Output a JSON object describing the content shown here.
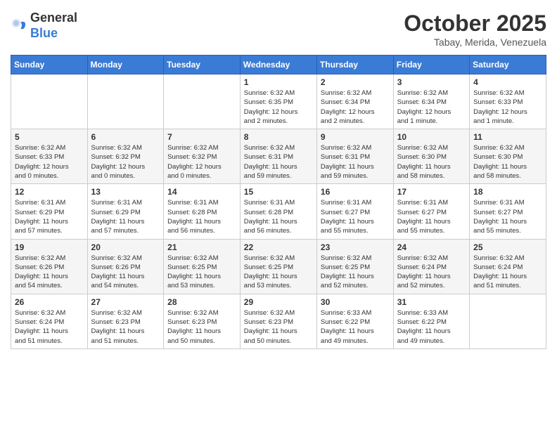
{
  "header": {
    "logo": {
      "general": "General",
      "blue": "Blue"
    },
    "title": "October 2025",
    "location": "Tabay, Merida, Venezuela"
  },
  "days_of_week": [
    "Sunday",
    "Monday",
    "Tuesday",
    "Wednesday",
    "Thursday",
    "Friday",
    "Saturday"
  ],
  "weeks": [
    [
      {
        "day": "",
        "info": ""
      },
      {
        "day": "",
        "info": ""
      },
      {
        "day": "",
        "info": ""
      },
      {
        "day": "1",
        "info": "Sunrise: 6:32 AM\nSunset: 6:35 PM\nDaylight: 12 hours\nand 2 minutes."
      },
      {
        "day": "2",
        "info": "Sunrise: 6:32 AM\nSunset: 6:34 PM\nDaylight: 12 hours\nand 2 minutes."
      },
      {
        "day": "3",
        "info": "Sunrise: 6:32 AM\nSunset: 6:34 PM\nDaylight: 12 hours\nand 1 minute."
      },
      {
        "day": "4",
        "info": "Sunrise: 6:32 AM\nSunset: 6:33 PM\nDaylight: 12 hours\nand 1 minute."
      }
    ],
    [
      {
        "day": "5",
        "info": "Sunrise: 6:32 AM\nSunset: 6:33 PM\nDaylight: 12 hours\nand 0 minutes."
      },
      {
        "day": "6",
        "info": "Sunrise: 6:32 AM\nSunset: 6:32 PM\nDaylight: 12 hours\nand 0 minutes."
      },
      {
        "day": "7",
        "info": "Sunrise: 6:32 AM\nSunset: 6:32 PM\nDaylight: 12 hours\nand 0 minutes."
      },
      {
        "day": "8",
        "info": "Sunrise: 6:32 AM\nSunset: 6:31 PM\nDaylight: 11 hours\nand 59 minutes."
      },
      {
        "day": "9",
        "info": "Sunrise: 6:32 AM\nSunset: 6:31 PM\nDaylight: 11 hours\nand 59 minutes."
      },
      {
        "day": "10",
        "info": "Sunrise: 6:32 AM\nSunset: 6:30 PM\nDaylight: 11 hours\nand 58 minutes."
      },
      {
        "day": "11",
        "info": "Sunrise: 6:32 AM\nSunset: 6:30 PM\nDaylight: 11 hours\nand 58 minutes."
      }
    ],
    [
      {
        "day": "12",
        "info": "Sunrise: 6:31 AM\nSunset: 6:29 PM\nDaylight: 11 hours\nand 57 minutes."
      },
      {
        "day": "13",
        "info": "Sunrise: 6:31 AM\nSunset: 6:29 PM\nDaylight: 11 hours\nand 57 minutes."
      },
      {
        "day": "14",
        "info": "Sunrise: 6:31 AM\nSunset: 6:28 PM\nDaylight: 11 hours\nand 56 minutes."
      },
      {
        "day": "15",
        "info": "Sunrise: 6:31 AM\nSunset: 6:28 PM\nDaylight: 11 hours\nand 56 minutes."
      },
      {
        "day": "16",
        "info": "Sunrise: 6:31 AM\nSunset: 6:27 PM\nDaylight: 11 hours\nand 55 minutes."
      },
      {
        "day": "17",
        "info": "Sunrise: 6:31 AM\nSunset: 6:27 PM\nDaylight: 11 hours\nand 55 minutes."
      },
      {
        "day": "18",
        "info": "Sunrise: 6:31 AM\nSunset: 6:27 PM\nDaylight: 11 hours\nand 55 minutes."
      }
    ],
    [
      {
        "day": "19",
        "info": "Sunrise: 6:32 AM\nSunset: 6:26 PM\nDaylight: 11 hours\nand 54 minutes."
      },
      {
        "day": "20",
        "info": "Sunrise: 6:32 AM\nSunset: 6:26 PM\nDaylight: 11 hours\nand 54 minutes."
      },
      {
        "day": "21",
        "info": "Sunrise: 6:32 AM\nSunset: 6:25 PM\nDaylight: 11 hours\nand 53 minutes."
      },
      {
        "day": "22",
        "info": "Sunrise: 6:32 AM\nSunset: 6:25 PM\nDaylight: 11 hours\nand 53 minutes."
      },
      {
        "day": "23",
        "info": "Sunrise: 6:32 AM\nSunset: 6:25 PM\nDaylight: 11 hours\nand 52 minutes."
      },
      {
        "day": "24",
        "info": "Sunrise: 6:32 AM\nSunset: 6:24 PM\nDaylight: 11 hours\nand 52 minutes."
      },
      {
        "day": "25",
        "info": "Sunrise: 6:32 AM\nSunset: 6:24 PM\nDaylight: 11 hours\nand 51 minutes."
      }
    ],
    [
      {
        "day": "26",
        "info": "Sunrise: 6:32 AM\nSunset: 6:24 PM\nDaylight: 11 hours\nand 51 minutes."
      },
      {
        "day": "27",
        "info": "Sunrise: 6:32 AM\nSunset: 6:23 PM\nDaylight: 11 hours\nand 51 minutes."
      },
      {
        "day": "28",
        "info": "Sunrise: 6:32 AM\nSunset: 6:23 PM\nDaylight: 11 hours\nand 50 minutes."
      },
      {
        "day": "29",
        "info": "Sunrise: 6:32 AM\nSunset: 6:23 PM\nDaylight: 11 hours\nand 50 minutes."
      },
      {
        "day": "30",
        "info": "Sunrise: 6:33 AM\nSunset: 6:22 PM\nDaylight: 11 hours\nand 49 minutes."
      },
      {
        "day": "31",
        "info": "Sunrise: 6:33 AM\nSunset: 6:22 PM\nDaylight: 11 hours\nand 49 minutes."
      },
      {
        "day": "",
        "info": ""
      }
    ]
  ]
}
